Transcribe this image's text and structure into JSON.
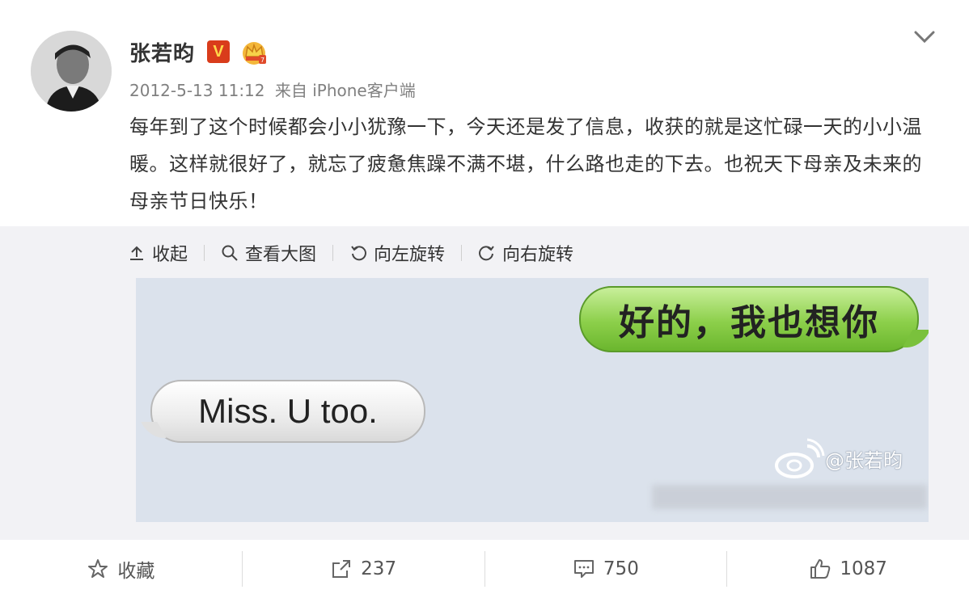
{
  "post": {
    "user": {
      "name": "张若昀",
      "verified_badge": "V",
      "avatar_icon": "avatar",
      "crown_icon": "crown-icon"
    },
    "meta": {
      "time": "2012-5-13 11:12",
      "source": "来自 iPhone客户端"
    },
    "text": "每年到了这个时候都会小小犹豫一下，今天还是发了信息，收获的就是这忙碌一天的小小温暖。这样就很好了，就忘了疲惫焦躁不满不堪，什么路也走的下去。也祝天下母亲及未来的母亲节日快乐！"
  },
  "media": {
    "toolbar": {
      "collapse": "收起",
      "view_large": "查看大图",
      "rotate_left": "向左旋转",
      "rotate_right": "向右旋转"
    },
    "image": {
      "green_bubble": "好的，我也想你",
      "white_bubble": "Miss. U too.",
      "watermark": "@张若昀"
    }
  },
  "actions": {
    "favorite": "收藏",
    "repost_count": "237",
    "comment_count": "750",
    "like_count": "1087"
  },
  "colors": {
    "accent_badge": "#d93c1b",
    "panel_bg": "#f2f2f5"
  }
}
